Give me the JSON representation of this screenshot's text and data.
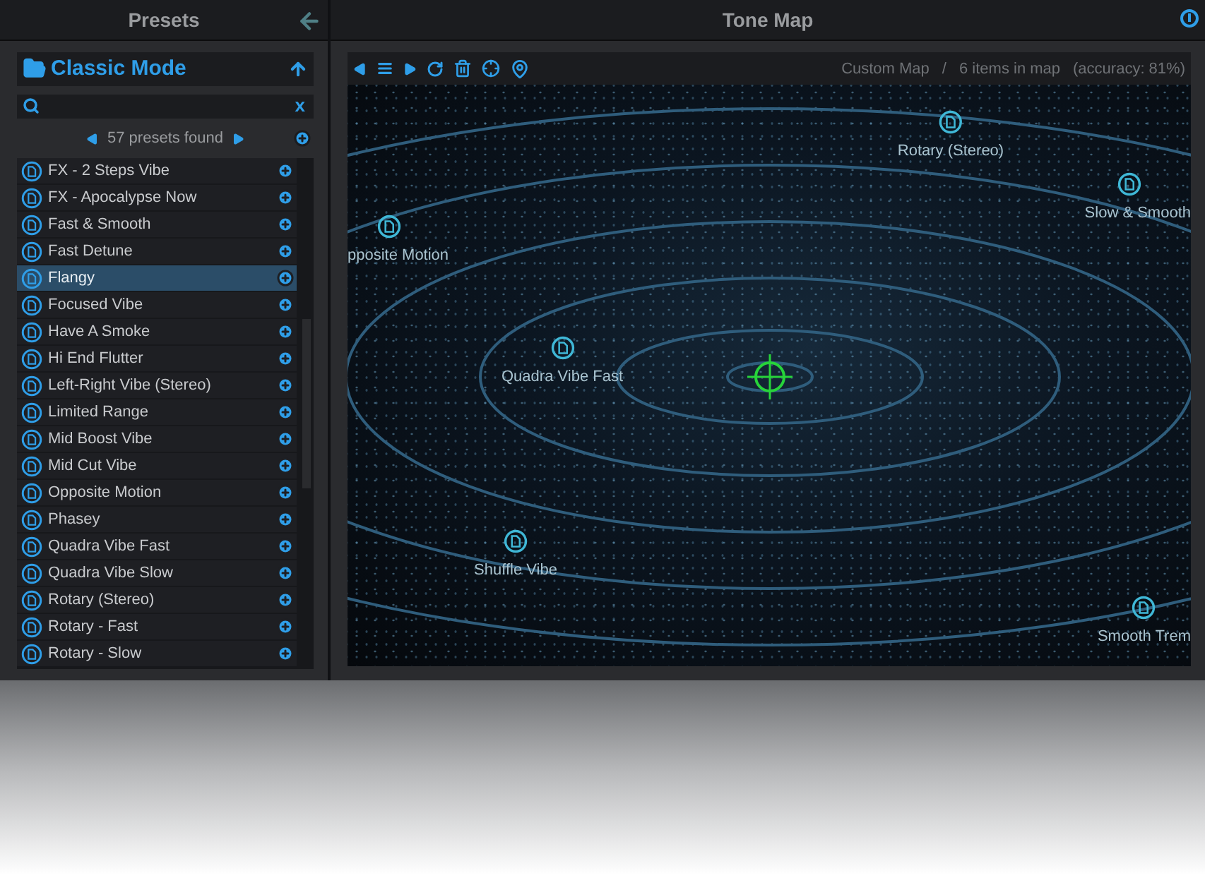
{
  "presets_panel": {
    "title": "Presets",
    "folder": "Classic Mode",
    "search": {
      "clear": "x"
    },
    "count": "57 presets found",
    "presets": [
      {
        "name": "FX - 2 Steps Vibe",
        "selected": false
      },
      {
        "name": "FX - Apocalypse Now",
        "selected": false
      },
      {
        "name": "Fast & Smooth",
        "selected": false
      },
      {
        "name": "Fast Detune",
        "selected": false
      },
      {
        "name": "Flangy",
        "selected": true
      },
      {
        "name": "Focused Vibe",
        "selected": false
      },
      {
        "name": "Have A Smoke",
        "selected": false
      },
      {
        "name": "Hi End Flutter",
        "selected": false
      },
      {
        "name": "Left-Right Vibe (Stereo)",
        "selected": false
      },
      {
        "name": "Limited Range",
        "selected": false
      },
      {
        "name": "Mid Boost Vibe",
        "selected": false
      },
      {
        "name": "Mid Cut Vibe",
        "selected": false
      },
      {
        "name": "Opposite Motion",
        "selected": false
      },
      {
        "name": "Phasey",
        "selected": false
      },
      {
        "name": "Quadra Vibe Fast",
        "selected": false
      },
      {
        "name": "Quadra Vibe Slow",
        "selected": false
      },
      {
        "name": "Rotary (Stereo)",
        "selected": false
      },
      {
        "name": "Rotary - Fast",
        "selected": false
      },
      {
        "name": "Rotary - Slow",
        "selected": false
      }
    ]
  },
  "tone_map": {
    "title": "Tone Map",
    "map_name": "Custom Map",
    "separator": "/",
    "items_count": "6 items in map",
    "accuracy": "(accuracy: 81%)",
    "markers": [
      {
        "label": "Rotary (Stereo)"
      },
      {
        "label": "Slow & Smooth"
      },
      {
        "label": "pposite Motion"
      },
      {
        "label": "Quadra Vibe Fast"
      },
      {
        "label": "Shuffle Vibe"
      },
      {
        "label": "Smooth Trem"
      }
    ]
  }
}
